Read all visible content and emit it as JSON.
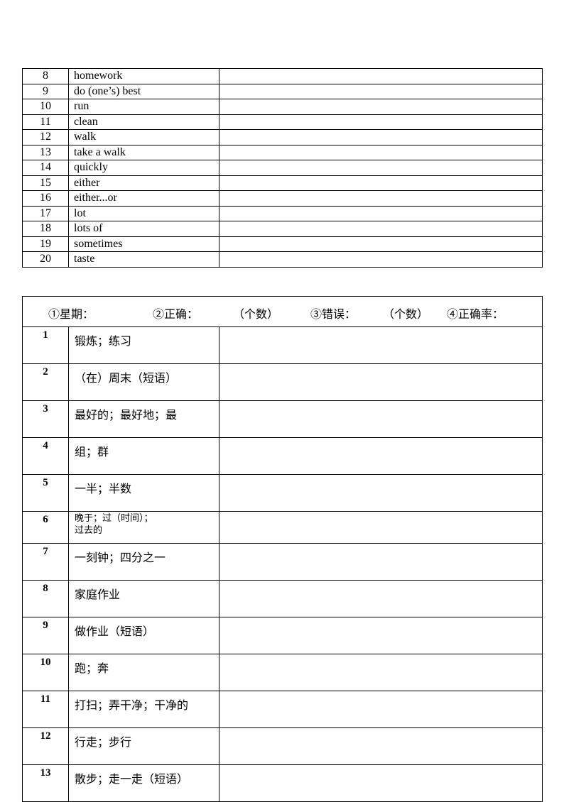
{
  "vocab_table": {
    "rows": [
      {
        "num": "8",
        "word": "homework",
        "answer": ""
      },
      {
        "num": "9",
        "word": "do (one’s) best",
        "answer": ""
      },
      {
        "num": "10",
        "word": "run",
        "answer": ""
      },
      {
        "num": "11",
        "word": "clean",
        "answer": ""
      },
      {
        "num": "12",
        "word": "walk",
        "answer": ""
      },
      {
        "num": "13",
        "word": "take a walk",
        "answer": ""
      },
      {
        "num": "14",
        "word": "quickly",
        "answer": ""
      },
      {
        "num": "15",
        "word": "either",
        "answer": ""
      },
      {
        "num": "16",
        "word": "either...or",
        "answer": ""
      },
      {
        "num": "17",
        "word": "lot",
        "answer": ""
      },
      {
        "num": "18",
        "word": "lots of",
        "answer": ""
      },
      {
        "num": "19",
        "word": "sometimes",
        "answer": ""
      },
      {
        "num": "20",
        "word": "taste",
        "answer": ""
      }
    ]
  },
  "quiz_table": {
    "header": {
      "weekday": "①星期：",
      "correct": "②正确：",
      "correct_unit": "（个数）",
      "wrong": "③错误：",
      "wrong_unit": "（个数）",
      "rate": "④正确率："
    },
    "rows": [
      {
        "num": "1",
        "meaning": "锻炼；练习",
        "answer": ""
      },
      {
        "num": "2",
        "meaning": "（在）周末（短语）",
        "answer": ""
      },
      {
        "num": "3",
        "meaning": "最好的；最好地；最",
        "answer": ""
      },
      {
        "num": "4",
        "meaning": "组；群",
        "answer": ""
      },
      {
        "num": "5",
        "meaning": "一半；半数",
        "answer": ""
      },
      {
        "num": "6",
        "meaning_line1": "晚于；过（时间）；",
        "meaning_line2": "过去的",
        "answer": ""
      },
      {
        "num": "7",
        "meaning": "一刻钟；四分之一",
        "answer": ""
      },
      {
        "num": "8",
        "meaning": "家庭作业",
        "answer": ""
      },
      {
        "num": "9",
        "meaning": "做作业（短语）",
        "answer": ""
      },
      {
        "num": "10",
        "meaning": "跑；奔",
        "answer": ""
      },
      {
        "num": "11",
        "meaning": "打扫；弄干净；干净的",
        "answer": ""
      },
      {
        "num": "12",
        "meaning": "行走；步行",
        "answer": ""
      },
      {
        "num": "13",
        "meaning": "散步；走一走（短语）",
        "answer": ""
      }
    ]
  }
}
